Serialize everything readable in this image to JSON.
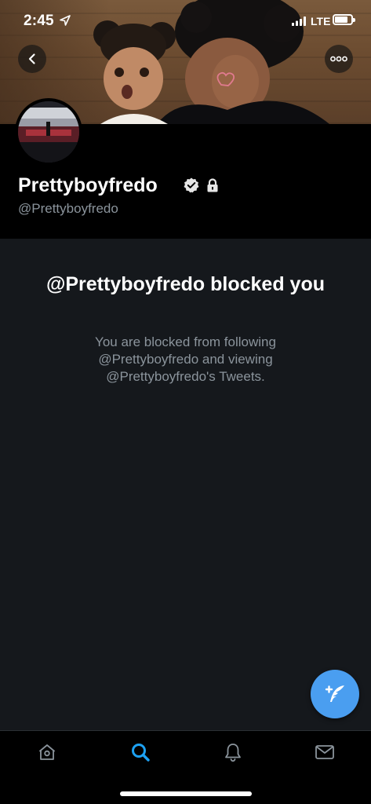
{
  "status_bar": {
    "time": "2:45",
    "network": "LTE"
  },
  "header": {
    "back_icon": "chevron-left-icon",
    "more_icon": "more-horizontal-icon"
  },
  "profile": {
    "display_name": "Prettyboyfredo",
    "handle": "@Prettyboyfredo",
    "verified_icon": "verified-badge-icon",
    "protected_icon": "lock-icon"
  },
  "blocked": {
    "title": "@Prettyboyfredo blocked you",
    "description": "You are blocked from following @Prettyboyfredo and viewing @Prettyboyfredo's Tweets."
  },
  "fab": {
    "icon": "compose-tweet-icon"
  },
  "tabbar": {
    "active_tab": "search",
    "tabs": [
      {
        "id": "home",
        "icon": "home-icon"
      },
      {
        "id": "search",
        "icon": "search-icon"
      },
      {
        "id": "notifications",
        "icon": "bell-icon"
      },
      {
        "id": "messages",
        "icon": "mail-icon"
      }
    ]
  },
  "colors": {
    "background": "#15181c",
    "header_background": "#000000",
    "accent": "#1da1f2",
    "fab": "#4a9ef0",
    "secondary_text": "#8b949c"
  }
}
